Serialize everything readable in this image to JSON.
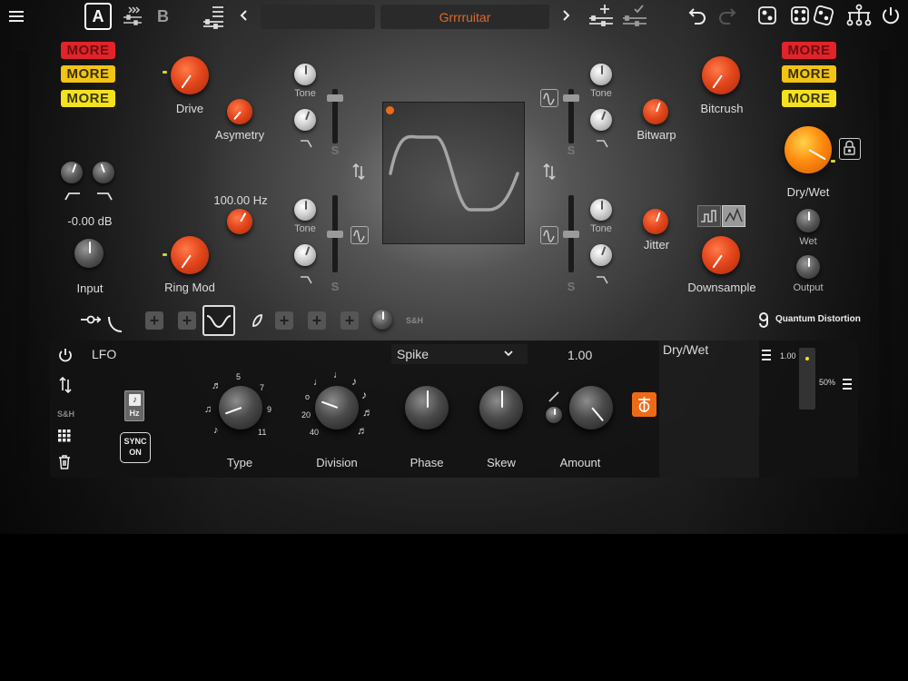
{
  "topbar": {
    "menu_icon": "hamburger-icon",
    "preset_a": "A",
    "preset_b": "B",
    "preset_left_value": "",
    "preset_name": "Grrrruitar",
    "accent": "#e0682d"
  },
  "left": {
    "more_labels": [
      "MORE",
      "MORE",
      "MORE"
    ],
    "drive_label": "Drive",
    "asymetry_label": "Asymetry",
    "ringmod_label": "Ring Mod",
    "ringmod_freq": "100.00 Hz",
    "input_db": "-0.00 dB",
    "input_label": "Input",
    "tone_labels": [
      "Tone",
      "Tone"
    ],
    "s_labels": [
      "S",
      "S"
    ]
  },
  "right": {
    "more_labels": [
      "MORE",
      "MORE",
      "MORE"
    ],
    "bitcrush_label": "Bitcrush",
    "bitwarp_label": "Bitwarp",
    "jitter_label": "Jitter",
    "downsample_label": "Downsample",
    "drywet_label": "Dry/Wet",
    "wet_label": "Wet",
    "output_label": "Output",
    "tone_labels": [
      "Tone",
      "Tone"
    ],
    "s_labels": [
      "S",
      "S"
    ]
  },
  "modrow": {
    "sh_label": "S&H",
    "brand": "Quantum Distortion"
  },
  "lfo": {
    "title": "LFO",
    "shape": "Spike",
    "value": "1.00",
    "dest_title": "Dry/Wet",
    "sh_label": "S&H",
    "hz_label": "Hz",
    "sync_label": "SYNC",
    "sync_state": "ON",
    "type_label": "Type",
    "division_label": "Division",
    "phase_label": "Phase",
    "skew_label": "Skew",
    "amount_label": "Amount",
    "type_numbers": [
      "5",
      "7",
      "9",
      "11"
    ],
    "division_numbers": [
      "o",
      "20",
      "40"
    ],
    "meter_value": "1.00",
    "meter_percent": "50%"
  }
}
